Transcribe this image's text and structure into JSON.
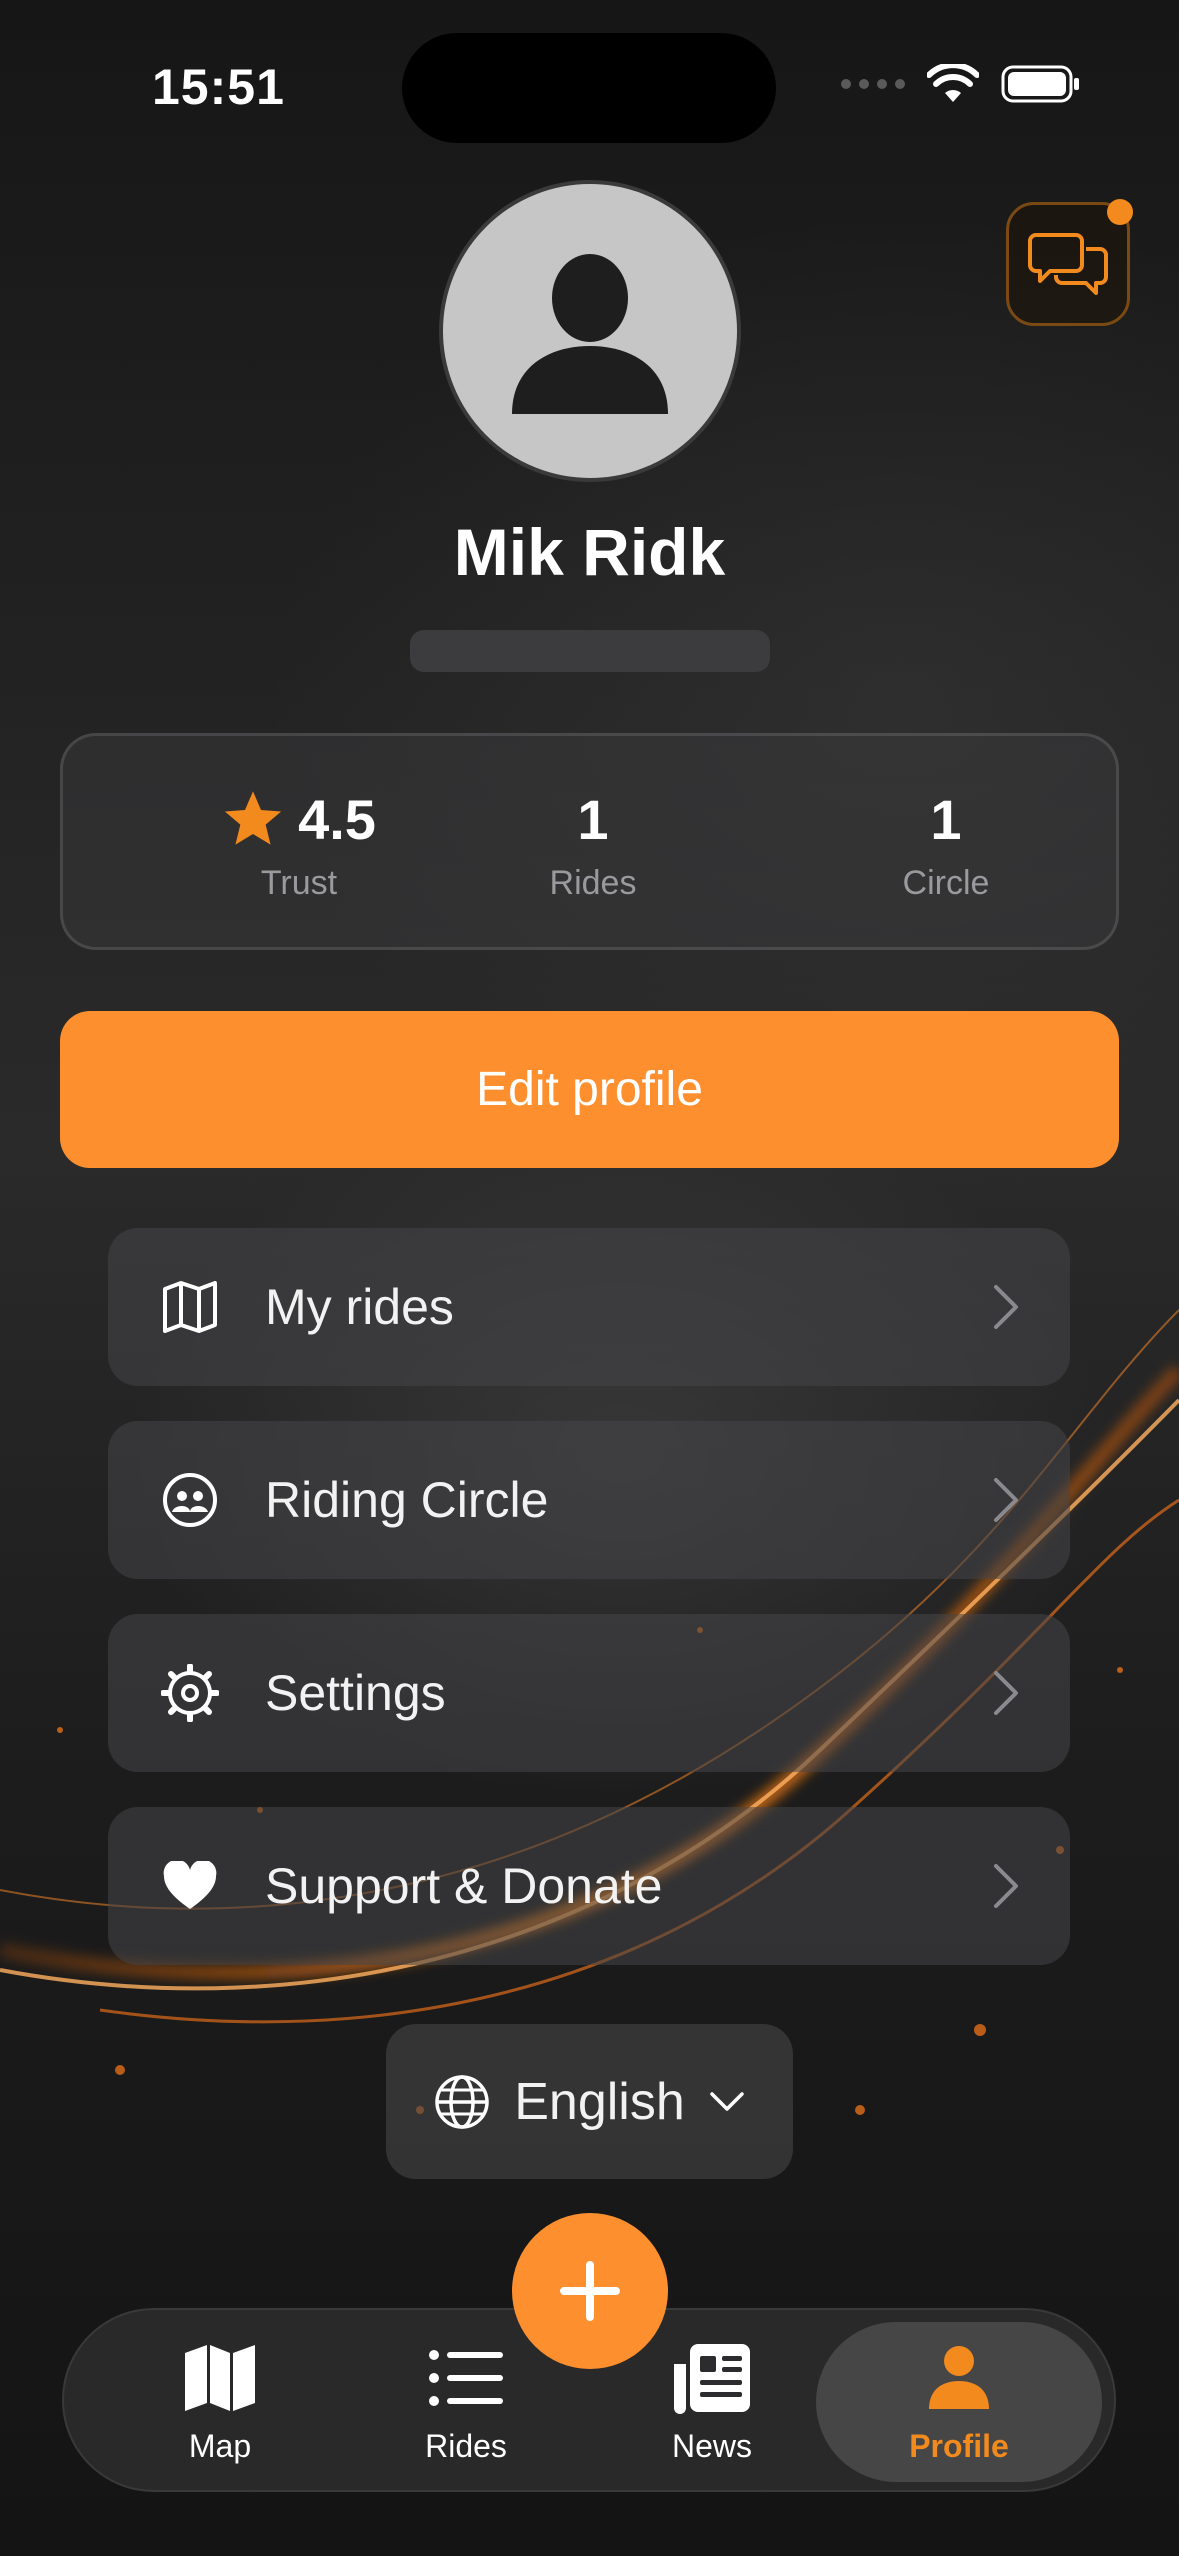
{
  "status_bar": {
    "time": "15:51"
  },
  "profile": {
    "name": "Mik Ridk"
  },
  "stats": [
    {
      "value": "4.5",
      "label": "Trust"
    },
    {
      "value": "1",
      "label": "Rides"
    },
    {
      "value": "1",
      "label": "Circle"
    }
  ],
  "edit_profile_label": "Edit profile",
  "menu": [
    {
      "label": "My rides",
      "icon": "map-icon"
    },
    {
      "label": "Riding Circle",
      "icon": "group-icon"
    },
    {
      "label": "Settings",
      "icon": "gear-icon"
    },
    {
      "label": "Support & Donate",
      "icon": "heart-icon"
    }
  ],
  "language": {
    "selected": "English"
  },
  "tabs": [
    {
      "label": "Map",
      "icon": "map-icon"
    },
    {
      "label": "Rides",
      "icon": "list-icon"
    },
    {
      "label": "News",
      "icon": "newspaper-icon"
    },
    {
      "label": "Profile",
      "icon": "person-icon",
      "active": true
    }
  ],
  "colors": {
    "accent": "#FD8F2E",
    "star": "#F28A1E",
    "background": "#1C1C1E"
  }
}
